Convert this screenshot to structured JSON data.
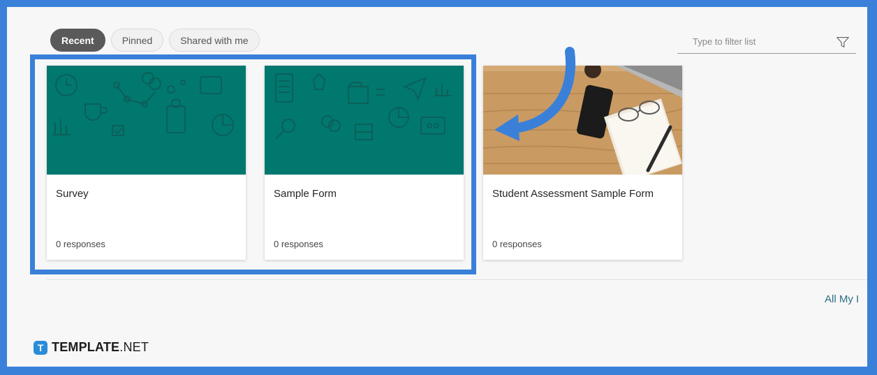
{
  "tabs": [
    {
      "label": "Recent",
      "active": true
    },
    {
      "label": "Pinned",
      "active": false
    },
    {
      "label": "Shared with me",
      "active": false
    }
  ],
  "filter": {
    "placeholder": "Type to filter list",
    "icon": "filter-icon"
  },
  "forms": [
    {
      "title": "Survey",
      "responses": "0 responses",
      "thumbnail": "teal-pattern"
    },
    {
      "title": "Sample Form",
      "responses": "0 responses",
      "thumbnail": "teal-pattern"
    },
    {
      "title": "Student Assessment Sample Form",
      "responses": "0 responses",
      "thumbnail": "desk-photo"
    }
  ],
  "all_link": "All My I",
  "brand": {
    "mark": "T",
    "bold": "TEMPLATE",
    "light": ".NET"
  },
  "colors": {
    "accent": "#3a80d9",
    "teal": "#00786e",
    "active_tab": "#5a5a5a",
    "link": "#2a6f86"
  }
}
